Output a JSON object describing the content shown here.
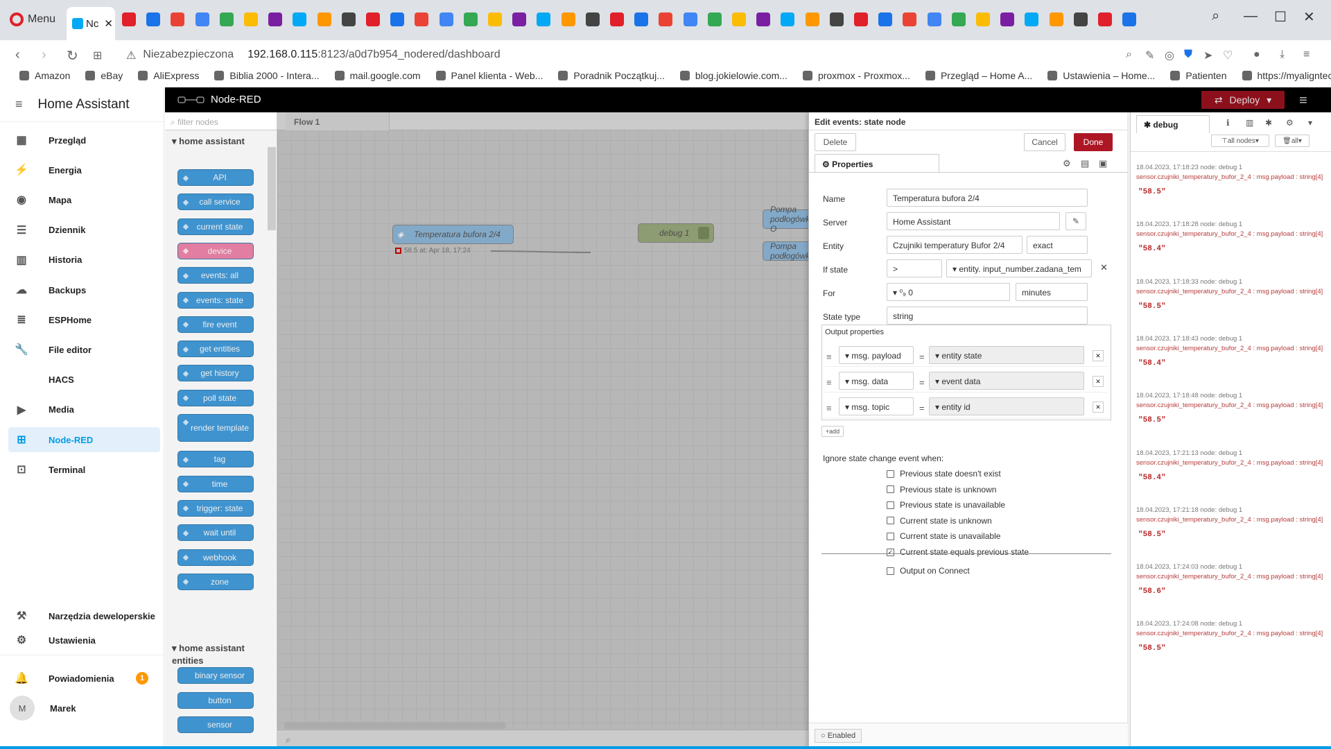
{
  "browser": {
    "menu_label": "Menu",
    "active_tab_label": "Nc",
    "address_security": "Niezabezpieczona",
    "address_host": "192.168.0.115",
    "address_path": ":8123/a0d7b954_nodered/dashboard",
    "bookmarks": [
      "Amazon",
      "eBay",
      "AliExpress",
      "Biblia 2000 - Intera...",
      "mail.google.com",
      "Panel klienta - Web...",
      "Poradnik Początkuj...",
      "blog.jokielowie.com...",
      "proxmox - Proxmox...",
      "Przegląd – Home A...",
      "Ustawienia – Home...",
      "Patienten",
      "https://myaligntech..."
    ],
    "favicon_colors": [
      "#e0202a",
      "#1a73e8",
      "#ea4335",
      "#4285f4",
      "#34a853",
      "#fbbc05",
      "#7b1fa2",
      "#03a9f4",
      "#ff9800",
      "#444444"
    ]
  },
  "ha_sidebar": {
    "title": "Home Assistant",
    "items": [
      {
        "label": "Przegląd",
        "icon": "dashboard-icon",
        "glyph": "▦"
      },
      {
        "label": "Energia",
        "icon": "lightning-icon",
        "glyph": "⚡"
      },
      {
        "label": "Mapa",
        "icon": "map-icon",
        "glyph": "◉"
      },
      {
        "label": "Dziennik",
        "icon": "list-icon",
        "glyph": "☰"
      },
      {
        "label": "Historia",
        "icon": "chart-icon",
        "glyph": "▥"
      },
      {
        "label": "Backups",
        "icon": "cloud-icon",
        "glyph": "☁"
      },
      {
        "label": "ESPHome",
        "icon": "esphome-icon",
        "glyph": "≣"
      },
      {
        "label": "File editor",
        "icon": "wrench-icon",
        "glyph": "🔧"
      },
      {
        "label": "HACS",
        "icon": "hacs-icon",
        "glyph": ""
      },
      {
        "label": "Media",
        "icon": "media-icon",
        "glyph": "▶"
      },
      {
        "label": "Node-RED",
        "icon": "sitemap-icon",
        "glyph": "⊞"
      },
      {
        "label": "Terminal",
        "icon": "terminal-icon",
        "glyph": "⊡"
      }
    ],
    "dev_tools": "Narzędzia deweloperskie",
    "settings": "Ustawienia",
    "notifications": "Powiadomienia",
    "notifications_count": "1",
    "user_initial": "M",
    "user_name": "Marek"
  },
  "nodered": {
    "app_title": "Node-RED",
    "deploy_label": "Deploy",
    "filter_placeholder": "filter nodes",
    "category1": "home assistant",
    "category2": "home assistant entities",
    "palette_nodes": [
      {
        "label": "API",
        "color": "#3f93cf"
      },
      {
        "label": "call service",
        "color": "#3f93cf"
      },
      {
        "label": "current state",
        "color": "#3f93cf"
      },
      {
        "label": "device",
        "color": "#e27ea1"
      },
      {
        "label": "events: all",
        "color": "#3f93cf"
      },
      {
        "label": "events: state",
        "color": "#3f93cf"
      },
      {
        "label": "fire event",
        "color": "#3f93cf"
      },
      {
        "label": "get entities",
        "color": "#3f93cf"
      },
      {
        "label": "get history",
        "color": "#3f93cf"
      },
      {
        "label": "poll state",
        "color": "#3f93cf"
      },
      {
        "label": "render template",
        "color": "#3f93cf"
      },
      {
        "label": "tag",
        "color": "#3f93cf"
      },
      {
        "label": "time",
        "color": "#3f93cf"
      },
      {
        "label": "trigger: state",
        "color": "#3f93cf"
      },
      {
        "label": "wait until",
        "color": "#3f93cf"
      },
      {
        "label": "webhook",
        "color": "#3f93cf"
      },
      {
        "label": "zone",
        "color": "#3f93cf"
      }
    ],
    "entity_nodes": [
      {
        "label": "binary sensor"
      },
      {
        "label": "button"
      },
      {
        "label": "sensor"
      }
    ],
    "flow_tab": "Flow 1",
    "workspace_nodes": {
      "source": "Temperatura bufora 2/4",
      "source_status": "58.5 at: Apr 18, 17:24",
      "debug": "debug 1",
      "pump1": "Pompa podłogówki O",
      "pump2": "Pompa podłogówki"
    }
  },
  "editor": {
    "title": "Edit events: state node",
    "delete": "Delete",
    "cancel": "Cancel",
    "done": "Done",
    "tab": "Properties",
    "name_label": "Name",
    "name_value": "Temperatura bufora 2/4",
    "server_label": "Server",
    "server_value": "Home Assistant",
    "entity_label": "Entity",
    "entity_value": "Czujniki temperatury Bufor 2/4",
    "entity_match": "exact",
    "ifstate_label": "If state",
    "ifstate_op": ">",
    "ifstate_type": "entity.",
    "ifstate_value": "input_number.zadana_tem",
    "for_label": "For",
    "for_value": "0",
    "for_unit": "minutes",
    "statetype_label": "State type",
    "statetype_value": "string",
    "output_label": "Output properties",
    "outputs": [
      {
        "prefix": "msg.",
        "key": "payload",
        "value": "entity state"
      },
      {
        "prefix": "msg.",
        "key": "data",
        "value": "event data"
      },
      {
        "prefix": "msg.",
        "key": "topic",
        "value": "entity id"
      }
    ],
    "add_label": "add",
    "ignore_label": "Ignore state change event when:",
    "checks": [
      {
        "label": "Previous state doesn't exist",
        "checked": false
      },
      {
        "label": "Previous state is unknown",
        "checked": false
      },
      {
        "label": "Previous state is unavailable",
        "checked": false
      },
      {
        "label": "Current state is unknown",
        "checked": false
      },
      {
        "label": "Current state is unavailable",
        "checked": false
      },
      {
        "label": "Current state equals previous state",
        "checked": true
      }
    ],
    "output_on_connect": "Output on Connect",
    "enabled": "Enabled"
  },
  "debug": {
    "tab": "debug",
    "filter_nodes": "all nodes",
    "filter_all": "all",
    "messages": [
      {
        "meta": "18.04.2023, 17:18:23    node: debug 1",
        "src": "sensor.czujniki_temperatury_bufor_2_4 : msg.payload : string[4]",
        "val": "\"58.5\""
      },
      {
        "meta": "18.04.2023, 17:18:28    node: debug 1",
        "src": "sensor.czujniki_temperatury_bufor_2_4 : msg.payload : string[4]",
        "val": "\"58.4\""
      },
      {
        "meta": "18.04.2023, 17:18:33    node: debug 1",
        "src": "sensor.czujniki_temperatury_bufor_2_4 : msg.payload : string[4]",
        "val": "\"58.5\""
      },
      {
        "meta": "18.04.2023, 17:18:43    node: debug 1",
        "src": "sensor.czujniki_temperatury_bufor_2_4 : msg.payload : string[4]",
        "val": "\"58.4\""
      },
      {
        "meta": "18.04.2023, 17:18:48    node: debug 1",
        "src": "sensor.czujniki_temperatury_bufor_2_4 : msg.payload : string[4]",
        "val": "\"58.5\""
      },
      {
        "meta": "18.04.2023, 17:21:13    node: debug 1",
        "src": "sensor.czujniki_temperatury_bufor_2_4 : msg.payload : string[4]",
        "val": "\"58.4\""
      },
      {
        "meta": "18.04.2023, 17:21:18    node: debug 1",
        "src": "sensor.czujniki_temperatury_bufor_2_4 : msg.payload : string[4]",
        "val": "\"58.5\""
      },
      {
        "meta": "18.04.2023, 17:24:03    node: debug 1",
        "src": "sensor.czujniki_temperatury_bufor_2_4 : msg.payload : string[4]",
        "val": "\"58.6\""
      },
      {
        "meta": "18.04.2023, 17:24:08    node: debug 1",
        "src": "sensor.czujniki_temperatury_bufor_2_4 : msg.payload : string[4]",
        "val": "\"58.5\""
      }
    ]
  }
}
